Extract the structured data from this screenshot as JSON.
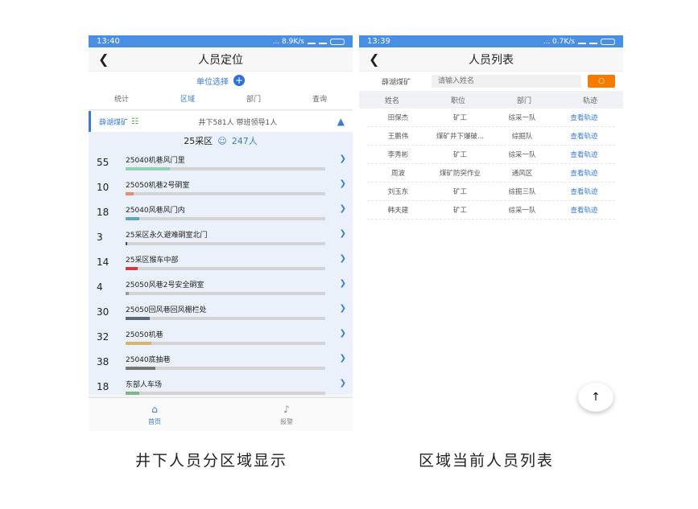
{
  "left": {
    "status": {
      "time": "13:40",
      "net": "... 8.9K/s",
      "battery": "86"
    },
    "title": "人员定位",
    "unit_select": "单位选择",
    "tabs": [
      "统计",
      "区域",
      "部门",
      "查询"
    ],
    "mine": {
      "name": "薛湖煤矿",
      "stats": "井下581人  带班领导1人"
    },
    "area": {
      "name": "25采区",
      "count": "247人"
    },
    "zones": [
      {
        "count": "55",
        "name": "25040机巷风门里",
        "fill": 0.22,
        "color": "#8fd1b0"
      },
      {
        "count": "10",
        "name": "25050机巷2号硐室",
        "fill": 0.04,
        "color": "#f08a6a"
      },
      {
        "count": "18",
        "name": "25040风巷风门内",
        "fill": 0.07,
        "color": "#5aa8b8"
      },
      {
        "count": "3",
        "name": "25采区永久避难硐室北门",
        "fill": 0.01,
        "color": "#2a4a7a"
      },
      {
        "count": "14",
        "name": "25采区猴车中部",
        "fill": 0.06,
        "color": "#d63a3a"
      },
      {
        "count": "4",
        "name": "25050风巷2号安全硐室",
        "fill": 0.015,
        "color": "#999999"
      },
      {
        "count": "30",
        "name": "25050回风巷回风栅栏处",
        "fill": 0.12,
        "color": "#5a6a7a"
      },
      {
        "count": "32",
        "name": "25050机巷",
        "fill": 0.13,
        "color": "#d9b36a"
      },
      {
        "count": "38",
        "name": "25040底抽巷",
        "fill": 0.15,
        "color": "#777777"
      },
      {
        "count": "18",
        "name": "东部人车场",
        "fill": 0.07,
        "color": "#7fb58a"
      }
    ],
    "bottom_nav": {
      "home": "首页",
      "alarm": "报警"
    }
  },
  "right": {
    "status": {
      "time": "13:39",
      "net": "... 0.7K/s",
      "battery": "87"
    },
    "title": "人员列表",
    "search": {
      "mine": "薛湖煤矿",
      "placeholder": "请输入姓名"
    },
    "columns": [
      "姓名",
      "职位",
      "部门",
      "轨迹"
    ],
    "rows": [
      [
        "田保杰",
        "矿工",
        "综采一队",
        "查看轨迹"
      ],
      [
        "王鹏伟",
        "煤矿井下爆破...",
        "综掘队",
        "查看轨迹"
      ],
      [
        "李秀彬",
        "矿工",
        "综采一队",
        "查看轨迹"
      ],
      [
        "周波",
        "煤矿防突作业",
        "通风区",
        "查看轨迹"
      ],
      [
        "刘玉东",
        "矿工",
        "综掘三队",
        "查看轨迹"
      ],
      [
        "韩夫建",
        "矿工",
        "综采一队",
        "查看轨迹"
      ]
    ]
  },
  "captions": [
    "井下人员分区域显示",
    "区域当前人员列表"
  ]
}
